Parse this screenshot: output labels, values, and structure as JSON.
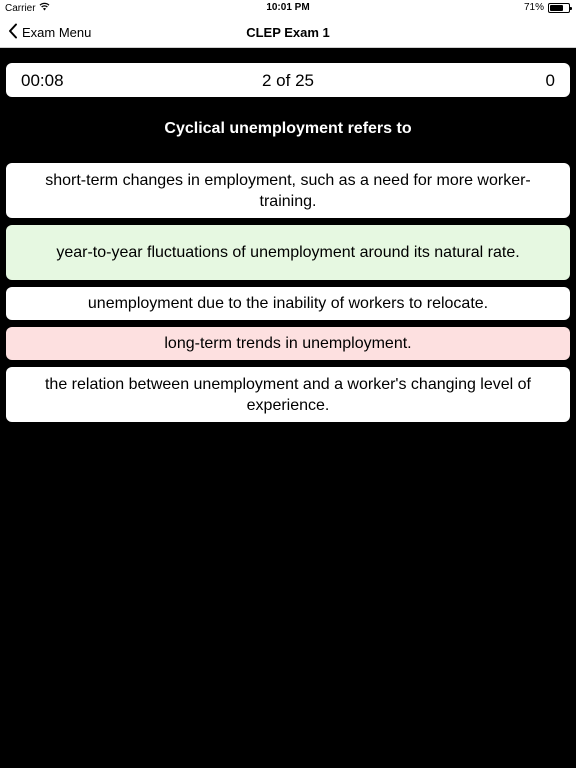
{
  "status_bar": {
    "carrier": "Carrier",
    "time": "10:01 PM",
    "battery_text": "71%",
    "battery_level": 0.71,
    "wifi_icon": "wifi-icon"
  },
  "nav": {
    "back_label": "Exam Menu",
    "back_icon": "chevron-left-icon",
    "title": "CLEP Exam 1"
  },
  "exam": {
    "timer": "00:08",
    "progress": "2 of 25",
    "score": "0"
  },
  "question": {
    "text": "Cyclical unemployment refers to",
    "answers": [
      {
        "text": "short-term changes in employment, such as a need for more worker-training.",
        "state": "neutral"
      },
      {
        "text": "year-to-year fluctuations of unemployment around its natural rate.",
        "state": "correct"
      },
      {
        "text": "unemployment due to the inability of workers to relocate.",
        "state": "neutral"
      },
      {
        "text": "long-term trends in unemployment.",
        "state": "wrong"
      },
      {
        "text": "the relation between unemployment and a worker's changing level of experience.",
        "state": "neutral"
      }
    ]
  },
  "colors": {
    "background": "#000000",
    "correct": "#e6f8e1",
    "wrong": "#fde0e0",
    "card": "#ffffff"
  }
}
